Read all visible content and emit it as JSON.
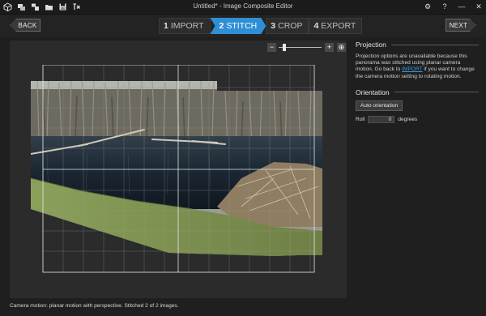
{
  "window": {
    "title": "Untitled* - Image Composite Editor",
    "controls": {
      "settings": "⚙",
      "help": "?",
      "minimize": "—",
      "close": "✕"
    }
  },
  "quick_access": [
    "new-panorama-icon",
    "new-video-panorama-icon",
    "open-icon",
    "folder-icon",
    "save-icon",
    "export-icon"
  ],
  "workflow": {
    "back_label": "BACK",
    "next_label": "NEXT",
    "steps": [
      {
        "num": "1",
        "label": "IMPORT"
      },
      {
        "num": "2",
        "label": "STITCH"
      },
      {
        "num": "3",
        "label": "CROP"
      },
      {
        "num": "4",
        "label": "EXPORT"
      }
    ],
    "active_step": 1
  },
  "zoom": {
    "minus": "−",
    "plus": "+",
    "fit": "⊕",
    "level": 0.1
  },
  "panel": {
    "projection": {
      "heading": "Projection",
      "note_before": "Projection options are unavailable because this panorama was stitched using planar camera motion. Go back to ",
      "note_link": "IMPORT",
      "note_after": " if you want to change the camera motion setting to rotating motion."
    },
    "orientation": {
      "heading": "Orientation",
      "auto_button": "Auto orientation",
      "roll_label": "Roll",
      "roll_value": "0",
      "roll_unit": "degrees"
    }
  },
  "status": "Camera motion: planar motion with perspective. Stitched 2 of 2 images.",
  "colors": {
    "accent": "#2e8fd6",
    "background": "#1f1f1f",
    "canvas": "#2b2b2b"
  }
}
